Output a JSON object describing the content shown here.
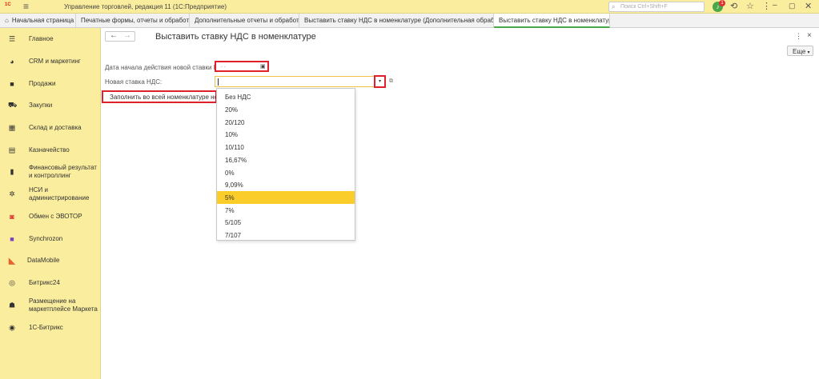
{
  "topbar": {
    "logo": "1С",
    "logo_sup": "",
    "app_title": "Управление торговлей, редакция 11  (1С:Предприятие)",
    "search_placeholder": "Поиск Ctrl+Shift+F",
    "notification_count": "1"
  },
  "tabs": [
    {
      "label": "Начальная страница",
      "closable": false
    },
    {
      "label": "Печатные формы, отчеты и обработки",
      "closable": true
    },
    {
      "label": "Дополнительные отчеты и обработки",
      "closable": true
    },
    {
      "label": "Выставить ставку НДС в номенклатуре (Дополнительная обработка)",
      "closable": true
    },
    {
      "label": "Выставить ставку НДС в номенклатуре",
      "closable": true,
      "active": true
    }
  ],
  "sidebar": {
    "items": [
      {
        "label": "Главное",
        "icon": "list-icon"
      },
      {
        "label": "CRM и маркетинг",
        "icon": "pie-chart-icon"
      },
      {
        "label": "Продажи",
        "icon": "bag-icon"
      },
      {
        "label": "Закупки",
        "icon": "cart-icon"
      },
      {
        "label": "Склад и доставка",
        "icon": "warehouse-icon"
      },
      {
        "label": "Казначейство",
        "icon": "coins-icon"
      },
      {
        "label": "Финансовый результат и контроллинг",
        "icon": "bar-chart-icon"
      },
      {
        "label": "НСИ и администрирование",
        "icon": "gear-icon"
      },
      {
        "label": "Обмен с ЭВОТОР",
        "icon": "evotor-icon"
      },
      {
        "label": "Synchrozon",
        "icon": "synchrozon-icon"
      },
      {
        "label": "DataMobile",
        "icon": "datamobile-icon"
      },
      {
        "label": "Битрикс24",
        "icon": "bitrix24-icon"
      },
      {
        "label": "Размещение на маркетплейсе Маркета",
        "icon": "marketplace-icon"
      },
      {
        "label": "1С-Битрикс",
        "icon": "bitrix-icon"
      }
    ]
  },
  "main": {
    "title": "Выставить ставку НДС в номенклатуре",
    "more_button": "Еще",
    "date_label": "Дата начала действия новой ставки НДС:",
    "date_value": ". .",
    "rate_label": "Новая ставка НДС:",
    "fill_button": "Заполнить во всей номенклатуре новую ставку НДС"
  },
  "dropdown": {
    "options": [
      "Без НДС",
      "20%",
      "20/120",
      "10%",
      "10/110",
      "16,67%",
      "0%",
      "9,09%",
      "5%",
      "7%",
      "5/105",
      "7/107"
    ],
    "selected": "5%"
  },
  "colors": {
    "panel": "#fbed9e",
    "highlight": "#fbcd2a",
    "annotation": "#e0202a",
    "accent": "#4aa84a"
  }
}
